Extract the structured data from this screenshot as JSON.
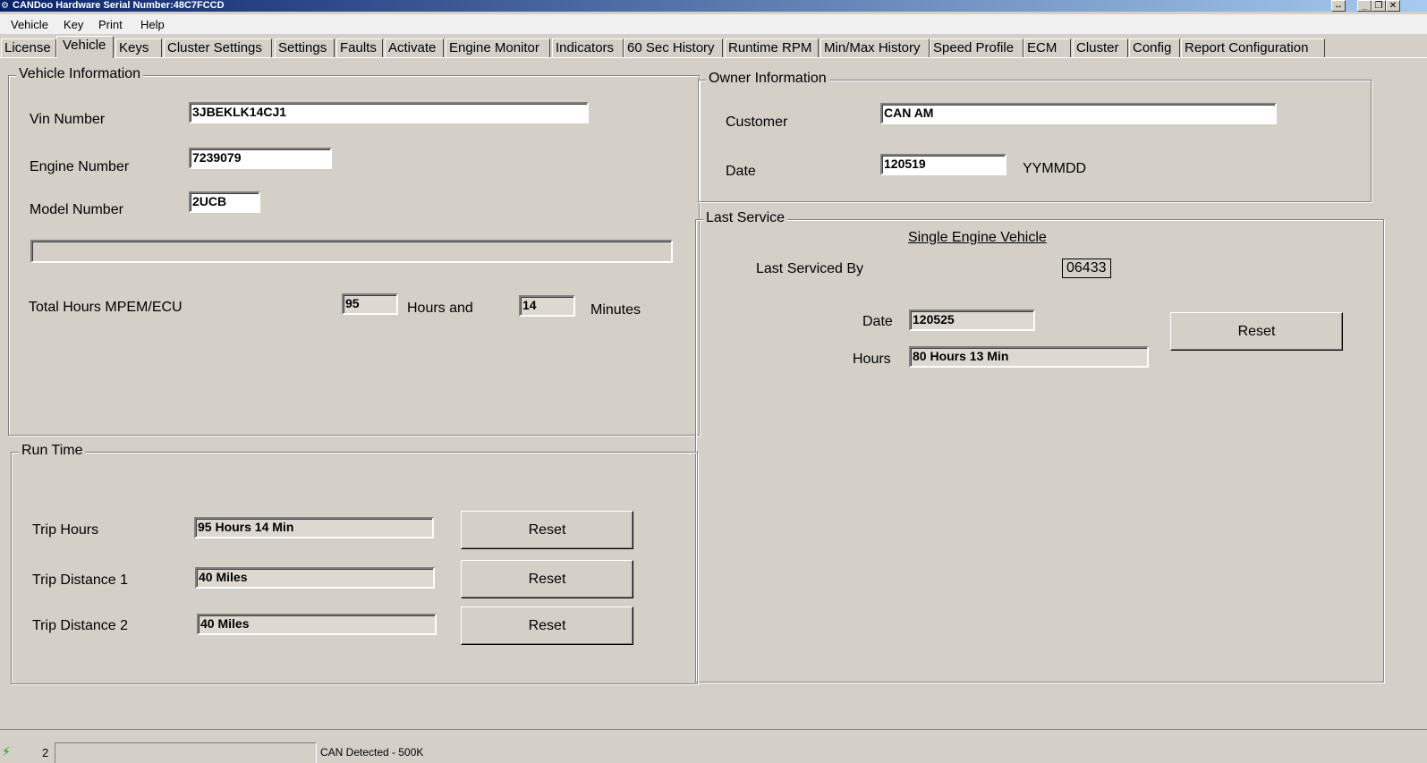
{
  "window": {
    "title": "CANDoo  Hardware Serial Number:48C7FCCD",
    "controls": {
      "resize": "↔",
      "minimize": "_",
      "restore": "❐",
      "close": "✕"
    }
  },
  "menu": [
    "Vehicle",
    "Key",
    "Print",
    "Help"
  ],
  "tabs": [
    "License",
    "Vehicle",
    "Keys",
    "Cluster Settings",
    "Settings",
    "Faults",
    "Activate",
    "Engine Monitor",
    "Indicators",
    "60 Sec History",
    "Runtime RPM",
    "Min/Max History",
    "Speed Profile",
    "ECM",
    "Cluster",
    "Config",
    "Report Configuration"
  ],
  "vehicle_info": {
    "title": "Vehicle Information",
    "vin_label": "Vin Number",
    "vin": "3JBEKLK14CJ1",
    "engine_label": "Engine Number",
    "engine": "7239079",
    "model_label": "Model Number",
    "model": "2UCB",
    "total_hours_label": "Total Hours MPEM/ECU",
    "hours": "95",
    "hours_and": "Hours and",
    "minutes": "14",
    "minutes_label": "Minutes"
  },
  "owner_info": {
    "title": "Owner Information",
    "customer_label": "Customer",
    "customer": "CAN AM",
    "date_label": "Date",
    "date": "120519",
    "date_format": "YYMMDD"
  },
  "last_service": {
    "title": "Last Service",
    "heading": "Single Engine Vehicle",
    "serviced_by_label": "Last Serviced By",
    "serviced_by": "06433",
    "date_label": "Date",
    "date": "120525",
    "hours_label": "Hours",
    "hours": "80 Hours  13 Min",
    "reset_label": "Reset"
  },
  "run_time": {
    "title": "Run Time",
    "trip_hours_label": "Trip Hours",
    "trip_hours": "95 Hours  14 Min",
    "trip1_label": "Trip Distance 1",
    "trip1": "40 Miles",
    "trip2_label": "Trip Distance 2",
    "trip2": "40 Miles",
    "reset_label": "Reset"
  },
  "status": {
    "number": "2",
    "message": "CAN Detected - 500K"
  }
}
